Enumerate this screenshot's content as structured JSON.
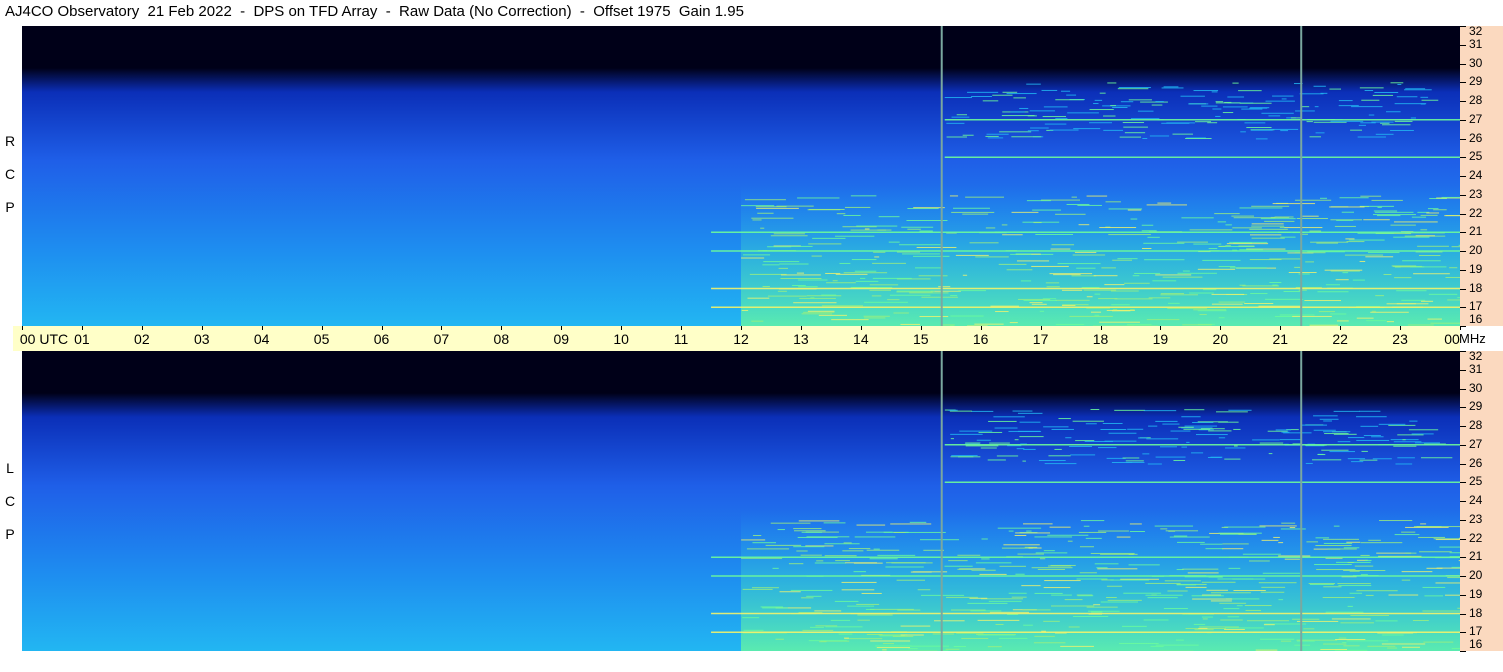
{
  "title": "AJ4CO Observatory  21 Feb 2022  -  DPS on TFD Array  -  Raw Data (No Correction)  -  Offset 1975  Gain 1.95",
  "top_panel_label": [
    "R",
    "C",
    "P"
  ],
  "bottom_panel_label": [
    "L",
    "C",
    "P"
  ],
  "frequency_unit": "MHz",
  "time_ticks": [
    "00 UTC",
    "01",
    "02",
    "03",
    "04",
    "05",
    "06",
    "07",
    "08",
    "09",
    "10",
    "11",
    "12",
    "13",
    "14",
    "15",
    "16",
    "17",
    "18",
    "19",
    "20",
    "21",
    "22",
    "23",
    "00"
  ],
  "freq_ticks": [
    "32",
    "31",
    "30",
    "29",
    "28",
    "27",
    "26",
    "25",
    "24",
    "23",
    "22",
    "21",
    "20",
    "19",
    "18",
    "17",
    "16"
  ],
  "colors": {
    "background_dark": "#000018",
    "band_blue": "#1f5fe8",
    "band_cyan": "#22b6f2",
    "emission_green": "#6dfc9a",
    "emission_yellow": "#f4f46a",
    "axis_yellow": "#ffffc8",
    "axis_peach": "#fbd9bf",
    "marker_line": "#7aa8a0"
  },
  "chart_data": {
    "type": "heatmap",
    "title": "AJ4CO Observatory  21 Feb 2022  -  DPS on TFD Array  -  Raw Data (No Correction)  -  Offset 1975  Gain 1.95",
    "x": {
      "unit": "UTC hour",
      "range": [
        0,
        24
      ]
    },
    "y": {
      "unit": "MHz",
      "range": [
        16,
        32
      ]
    },
    "panels": [
      "RCP",
      "LCP"
    ],
    "vertical_markers_utc": [
      15.35,
      21.35
    ],
    "persistent_lines_mhz": [
      17.0,
      18.0,
      20.0,
      21.0,
      25.0,
      27.0
    ],
    "emission_onset_utc": 12.0
  }
}
